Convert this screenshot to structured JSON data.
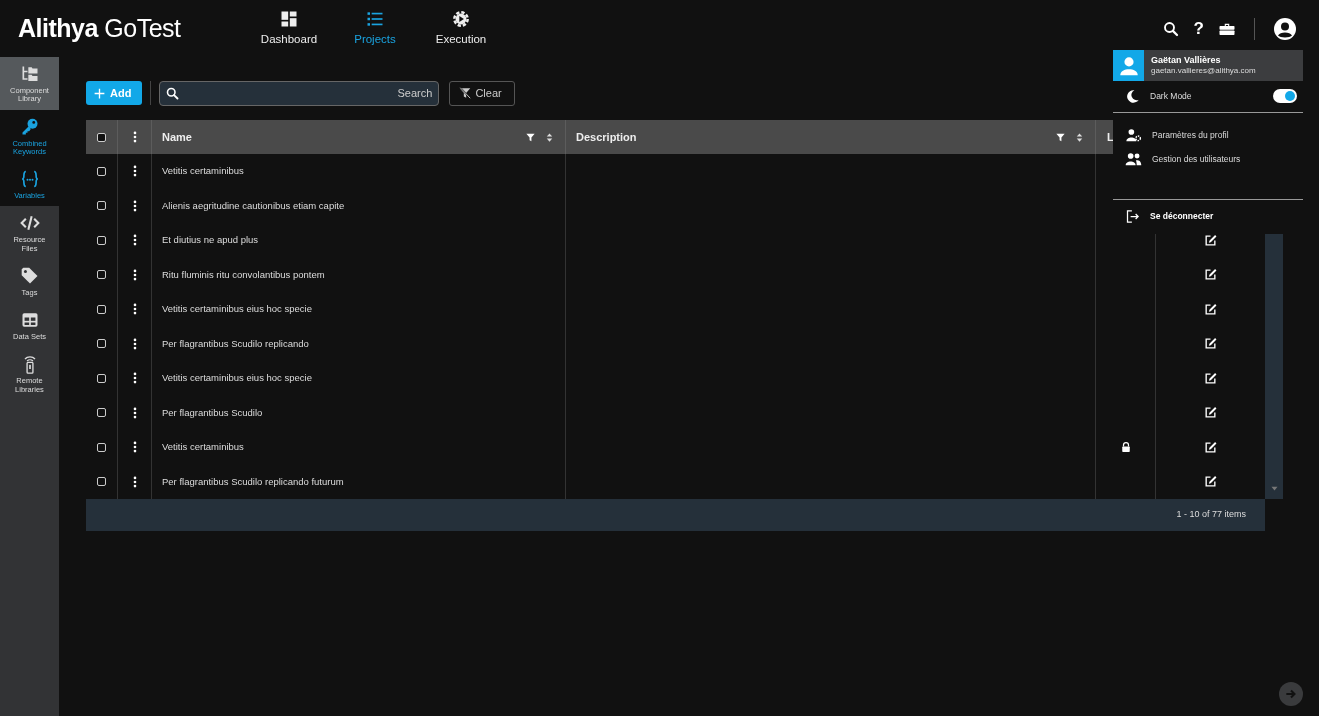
{
  "app": {
    "logo_bold": "Alithya",
    "logo_light": "GoTest"
  },
  "nav": [
    {
      "kind": "dashboard",
      "label": "Dashboard",
      "selected": false
    },
    {
      "kind": "projects",
      "label": "Projects",
      "selected": true
    },
    {
      "kind": "execution",
      "label": "Execution",
      "selected": false
    }
  ],
  "header_actions": [
    {
      "kind": "search"
    },
    {
      "kind": "help",
      "label": "?"
    },
    {
      "kind": "toolbox"
    },
    {
      "kind": "account"
    }
  ],
  "sidebar": {
    "items": [
      {
        "kind": "component",
        "label": "Component Library",
        "selected": true,
        "accent": false
      },
      {
        "kind": "key",
        "label": "Combined Keywords",
        "selected": false,
        "accent": true
      },
      {
        "kind": "variables",
        "label": "Variables",
        "selected": false,
        "accent": true
      },
      {
        "kind": "code",
        "label": "Resource Files",
        "selected": false,
        "accent": false
      },
      {
        "kind": "tag",
        "label": "Tags",
        "selected": false,
        "accent": false
      },
      {
        "kind": "grid",
        "label": "Data Sets",
        "selected": false,
        "accent": false
      },
      {
        "kind": "remote",
        "label": "Remote Libraries",
        "selected": false,
        "accent": false
      }
    ]
  },
  "toolbar": {
    "add": "Add",
    "search": {
      "placeholder": "Search"
    },
    "clear": "Clear"
  },
  "table": {
    "all_checked": false,
    "columns": [
      {
        "label": "Name",
        "filter": true
      },
      {
        "label": "Description",
        "filter": true
      },
      {
        "label": "L"
      }
    ],
    "rows": [
      {
        "name": "Vetitis certaminibus",
        "checked": false
      },
      {
        "name": "Alienis aegritudine cautionibus etiam capite",
        "checked": false
      },
      {
        "name": "Et diutius ne apud plus",
        "checked": false,
        "locked": false,
        "edit": true
      },
      {
        "name": "Ritu fluminis ritu convolantibus pontem",
        "checked": false,
        "locked": false,
        "edit": true
      },
      {
        "name": "Vetitis certaminibus eius hoc specie",
        "checked": false,
        "locked": false,
        "edit": true
      },
      {
        "name": "Per flagrantibus Scudilo replicando",
        "checked": false,
        "locked": false,
        "edit": true
      },
      {
        "name": "Vetitis certaminibus eius hoc specie",
        "checked": false,
        "locked": false,
        "edit": true
      },
      {
        "name": "Per flagrantibus Scudilo",
        "checked": false,
        "locked": false,
        "edit": true
      },
      {
        "name": "Vetitis certaminibus",
        "checked": false,
        "locked": true,
        "edit": true
      },
      {
        "name": "Per flagrantibus Scudilo replicando futurum",
        "checked": false,
        "locked": false,
        "edit": true
      }
    ],
    "pager": "1 - 10 of 77 items"
  },
  "user_menu": {
    "name": "Gaëtan Vallières",
    "email": "gaetan.vallieres@alithya.com",
    "dark_mode": {
      "label": "Dark Mode",
      "on": true
    },
    "items": [
      {
        "kind": "profile",
        "label": "Paramètres du profil"
      },
      {
        "kind": "users",
        "label": "Gestion des utilisateurs"
      }
    ],
    "logout": "Se déconnecter"
  }
}
